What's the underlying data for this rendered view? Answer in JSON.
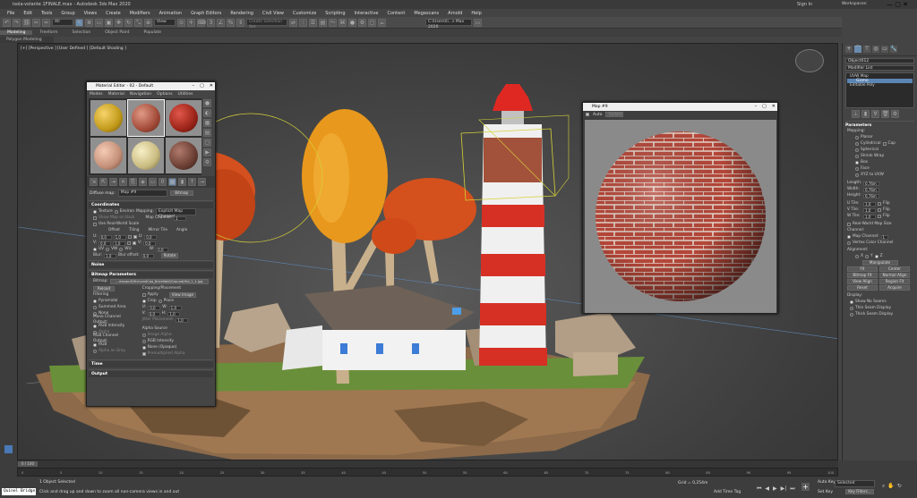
{
  "app": {
    "title": "isola-volante 1FINALE.max - Autodesk 3ds Max 2020",
    "sign_in": "Sign In",
    "workspaces_label": "Workspaces:",
    "workspace_value": "Default"
  },
  "menu": [
    "File",
    "Edit",
    "Tools",
    "Group",
    "Views",
    "Create",
    "Modifiers",
    "Animation",
    "Graph Editors",
    "Rendering",
    "Civil View",
    "Customize",
    "Scripting",
    "Interactive",
    "Content",
    "Megascans",
    "Arnold",
    "Help"
  ],
  "toolbar": {
    "filter_value": "All",
    "view_value": "View",
    "selection_set_placeholder": "Create Selection Set",
    "path_value": "C:\\Users\\li...s Max 2020"
  },
  "ribbon": {
    "tabs": [
      "Modeling",
      "Freeform",
      "Selection",
      "Object Paint",
      "Populate"
    ],
    "active": "Modeling",
    "sub": "Polygon Modeling"
  },
  "viewport": {
    "label": "[+] [Perspective ] [User Defined ] [Default Shading ]"
  },
  "material_editor": {
    "title": "Material Editor - 02 - Default",
    "menu": [
      "Modes",
      "Material",
      "Navigation",
      "Options",
      "Utilities"
    ],
    "map_label": "Diffuse map:",
    "map_value": "Map #9",
    "map_type": "Bitmap",
    "coords": {
      "header": "Coordinates",
      "texture": "Texture",
      "environ": "Environ",
      "mapping_label": "Mapping:",
      "mapping_value": "Explicit Map Channel",
      "show_map_back": "Show Map on Back",
      "map_channel_label": "Map Channel:",
      "map_channel": "1",
      "real_world": "Use Real-World Scale",
      "offset": "Offset",
      "tiling": "Tiling",
      "mirror_tile": "Mirror Tile",
      "angle": "Angle",
      "u_label": "U:",
      "u_offset": "0,0",
      "u_tiling": "1,0",
      "u_angle": "0,0",
      "v_label": "V:",
      "v_offset": "0,0",
      "v_tiling": "1,0",
      "v_angle": "0,0",
      "w_label": "W:",
      "w_angle": "0,0",
      "uv": "UV",
      "vw": "VW",
      "wu": "WU",
      "blur_label": "Blur:",
      "blur": "1,0",
      "blur_offset_label": "Blur offset:",
      "blur_offset": "0,0",
      "rotate": "Rotate"
    },
    "noise": "Noise",
    "bitmap": {
      "header": "Bitmap Parameters",
      "bitmap_label": "Bitmap:",
      "bitmap_path": "...rtexandi\\TerrLandCoa_BrickWall(Ground(Hld_1_1.jpg",
      "reload": "Reload",
      "cropping": "Cropping/Placement",
      "apply": "Apply",
      "view_image": "View Image",
      "crop": "Crop",
      "place": "Place",
      "u_val": "0,0",
      "w_val": "1,0",
      "v_val": "0,0",
      "h_val": "1,0",
      "jitter": "Jitter Placement:",
      "jitter_val": "1,0",
      "filtering": "Filtering",
      "pyramidal": "Pyramidal",
      "summed_area": "Summed Area",
      "none": "None",
      "mono_output": "Mono Channel Output:",
      "rgb_intensity": "RGB Intensity",
      "alpha": "Alpha",
      "rgb_output": "RGB Channel Output:",
      "rgb": "RGB",
      "alpha_as_gray": "Alpha as Gray",
      "alpha_source": "Alpha Source",
      "image_alpha": "Image Alpha",
      "rgb_intensity2": "RGB Intensity",
      "none_opaque": "None (Opaque)",
      "premultiplied": "Premultiplied Alpha"
    },
    "time": "Time",
    "output": "Output"
  },
  "map_window": {
    "title": "Map #9",
    "auto": "Auto",
    "update": "Update"
  },
  "command_panel": {
    "object_name": "Object012",
    "modifier_list": "Modifier List",
    "stack": [
      "UVW Map",
      "Gizmo",
      "Editable Poly"
    ],
    "stack_selected": "Gizmo",
    "parameters": "Parameters",
    "mapping": "Mapping:",
    "mapping_types": [
      "Planar",
      "Cylindrical",
      "Spherical",
      "Shrink Wrap",
      "Box",
      "Face",
      "XYZ to UVW"
    ],
    "mapping_selected": "Box",
    "cap": "Cap",
    "length_label": "Length:",
    "length": "0,76m",
    "width_label": "Width:",
    "width": "0,76m",
    "height_label": "Height:",
    "height": "0,76m",
    "utile_label": "U Tile:",
    "utile": "1,0",
    "vtile_label": "V Tile:",
    "vtile": "1,0",
    "wtile_label": "W Tile:",
    "wtile": "1,0",
    "flip": "Flip",
    "real_world": "Real-World Map Size",
    "channel": "Channel:",
    "map_channel": "Map Channel:",
    "map_channel_val": "1",
    "vertex_color": "Vertex Color Channel",
    "alignment": "Alignment:",
    "x": "X",
    "y": "Y",
    "z": "Z",
    "manipulate": "Manipulate",
    "fit": "Fit",
    "center": "Center",
    "bitmap_fit": "Bitmap Fit",
    "normal_align": "Normal Align",
    "view_align": "View Align",
    "region_fit": "Region Fit",
    "reset": "Reset",
    "acquire": "Acquire",
    "display": "Display:",
    "show_no_seams": "Show No Seams",
    "thin_seam": "Thin Seam Display",
    "thick_seam": "Thick Seam Display"
  },
  "bottom": {
    "frame": "0 / 100",
    "maxscript": "Quinel Bridge",
    "selected": "1 Object Selected",
    "hint": "Click and drag up and down to zoom all non-camera views in and out",
    "grid": "Grid = 0,254m",
    "add_time_tag": "Add Time Tag",
    "autokey": "Auto Key",
    "selected_dd": "Selected",
    "set_key": "Set Key",
    "key_filters": "Key Filters...",
    "ticks": [
      "0",
      "5",
      "10",
      "15",
      "20",
      "25",
      "30",
      "35",
      "40",
      "45",
      "50",
      "55",
      "60",
      "65",
      "70",
      "75",
      "80",
      "85",
      "90",
      "95",
      "100"
    ]
  }
}
